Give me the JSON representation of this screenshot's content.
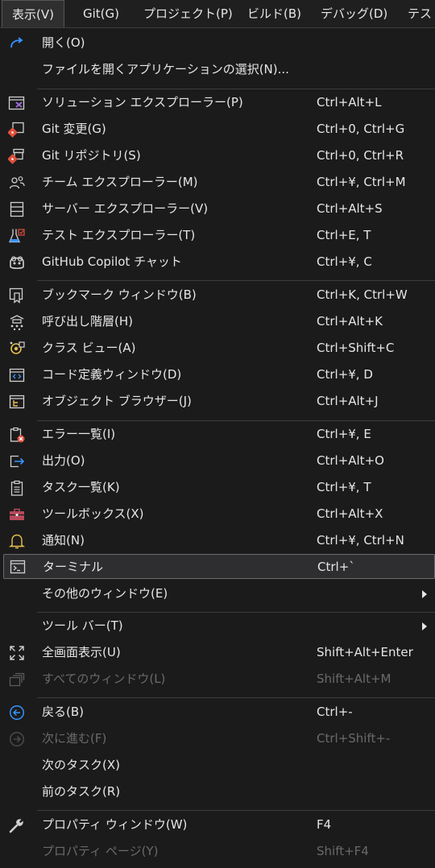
{
  "menubar": {
    "view": "表示(V)",
    "git": "Git(G)",
    "project": "プロジェクト(P)",
    "build": "ビルド(B)",
    "debug": "デバッグ(D)",
    "test": "テスト"
  },
  "menu": {
    "open": {
      "label": "開く(O)"
    },
    "open_with": {
      "label": "ファイルを開くアプリケーションの選択(N)..."
    },
    "solution_explorer": {
      "label": "ソリューション エクスプローラー(P)",
      "shortcut": "Ctrl+Alt+L"
    },
    "git_changes": {
      "label": "Git 変更(G)",
      "shortcut": "Ctrl+0, Ctrl+G"
    },
    "git_repository": {
      "label": "Git リポジトリ(S)",
      "shortcut": "Ctrl+0, Ctrl+R"
    },
    "team_explorer": {
      "label": "チーム エクスプローラー(M)",
      "shortcut": "Ctrl+¥, Ctrl+M"
    },
    "server_explorer": {
      "label": "サーバー エクスプローラー(V)",
      "shortcut": "Ctrl+Alt+S"
    },
    "test_explorer": {
      "label": "テスト エクスプローラー(T)",
      "shortcut": "Ctrl+E, T"
    },
    "copilot_chat": {
      "label": "GitHub Copilot チャット",
      "shortcut": "Ctrl+¥, C"
    },
    "bookmark_window": {
      "label": "ブックマーク ウィンドウ(B)",
      "shortcut": "Ctrl+K, Ctrl+W"
    },
    "call_hierarchy": {
      "label": "呼び出し階層(H)",
      "shortcut": "Ctrl+Alt+K"
    },
    "class_view": {
      "label": "クラス ビュー(A)",
      "shortcut": "Ctrl+Shift+C"
    },
    "code_definition": {
      "label": "コード定義ウィンドウ(D)",
      "shortcut": "Ctrl+¥, D"
    },
    "object_browser": {
      "label": "オブジェクト ブラウザー(J)",
      "shortcut": "Ctrl+Alt+J"
    },
    "error_list": {
      "label": "エラー一覧(I)",
      "shortcut": "Ctrl+¥, E"
    },
    "output": {
      "label": "出力(O)",
      "shortcut": "Ctrl+Alt+O"
    },
    "task_list": {
      "label": "タスク一覧(K)",
      "shortcut": "Ctrl+¥, T"
    },
    "toolbox": {
      "label": "ツールボックス(X)",
      "shortcut": "Ctrl+Alt+X"
    },
    "notifications": {
      "label": "通知(N)",
      "shortcut": "Ctrl+¥, Ctrl+N"
    },
    "terminal": {
      "label": "ターミナル",
      "shortcut": "Ctrl+`"
    },
    "other_windows": {
      "label": "その他のウィンドウ(E)"
    },
    "toolbars": {
      "label": "ツール バー(T)"
    },
    "full_screen": {
      "label": "全画面表示(U)",
      "shortcut": "Shift+Alt+Enter"
    },
    "all_windows": {
      "label": "すべてのウィンドウ(L)",
      "shortcut": "Shift+Alt+M"
    },
    "back": {
      "label": "戻る(B)",
      "shortcut": "Ctrl+-"
    },
    "forward": {
      "label": "次に進む(F)",
      "shortcut": "Ctrl+Shift+-"
    },
    "next_task": {
      "label": "次のタスク(X)"
    },
    "prev_task": {
      "label": "前のタスク(R)"
    },
    "properties_window": {
      "label": "プロパティ ウィンドウ(W)",
      "shortcut": "F4"
    },
    "property_pages": {
      "label": "プロパティ ページ(Y)",
      "shortcut": "Shift+F4"
    }
  },
  "colors": {
    "menu_bg": "#1b1b1c",
    "highlight_bg": "#2e2e30",
    "highlight_border": "#6b6b6b",
    "text": "#e6e6e6",
    "disabled_text": "#6a6a6a",
    "accent_blue": "#3794ff",
    "accent_purple": "#9b6cd8",
    "git_red": "#e0503c",
    "notify_yellow": "#e6c04c"
  }
}
